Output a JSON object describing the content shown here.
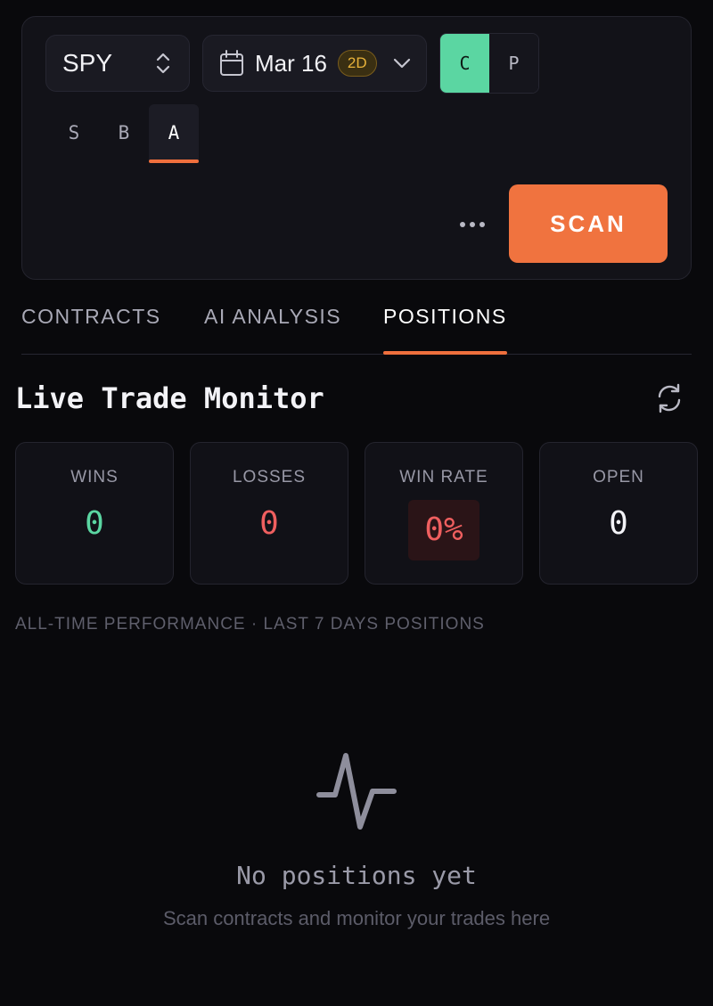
{
  "controls": {
    "ticker": "SPY",
    "date": "Mar 16",
    "date_badge": "2D",
    "call_label": "C",
    "put_label": "P",
    "segments": [
      "S",
      "B",
      "A"
    ],
    "scan_label": "SCAN"
  },
  "tabs": [
    "CONTRACTS",
    "AI ANALYSIS",
    "POSITIONS"
  ],
  "monitor": {
    "title": "Live Trade Monitor",
    "stats": [
      {
        "label": "WINS",
        "value": "0",
        "color": "#5bd6a2"
      },
      {
        "label": "LOSSES",
        "value": "0",
        "color": "#ef5f5f"
      },
      {
        "label": "WIN RATE",
        "value": "0%",
        "color": "#ef5f5f"
      },
      {
        "label": "OPEN",
        "value": "0",
        "color": "#f3f3f7"
      }
    ],
    "subtitle": "ALL-TIME PERFORMANCE · LAST 7 DAYS POSITIONS"
  },
  "empty": {
    "title": "No positions yet",
    "subtitle": "Scan contracts and monitor your trades here"
  },
  "colors": {
    "accent": "#ef6f3d",
    "call_active": "#5bd6a2",
    "badge": "#e8b23a"
  }
}
